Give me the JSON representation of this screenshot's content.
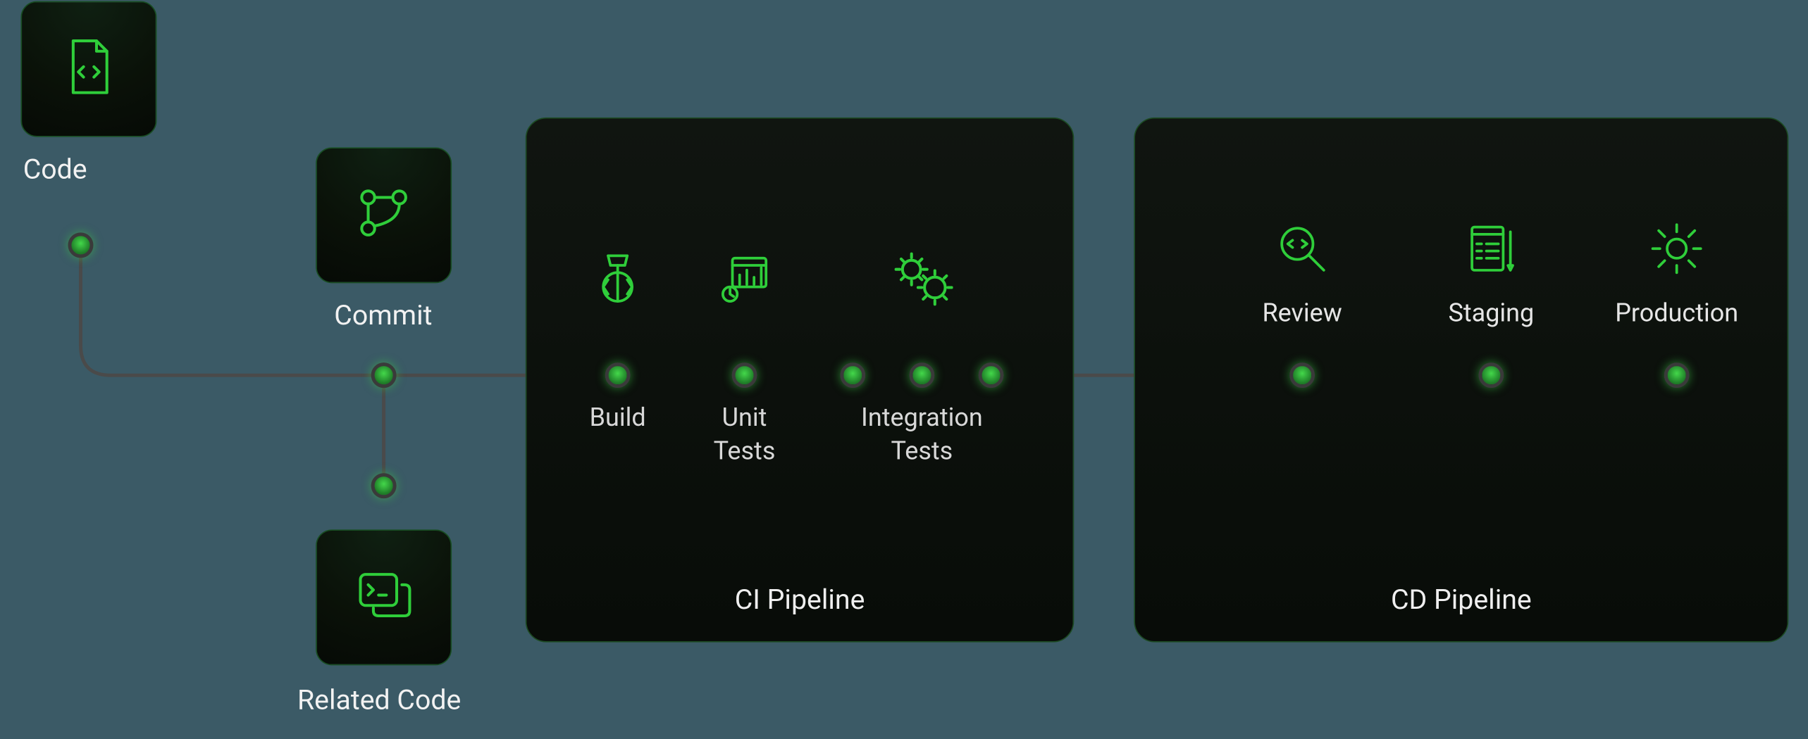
{
  "diagram": {
    "code_label": "Code",
    "commit_label": "Commit",
    "related_code_label": "Related Code",
    "ci_panel_title": "CI Pipeline",
    "cd_panel_title": "CD Pipeline",
    "ci_stages": {
      "build": "Build",
      "unit_tests_line1": "Unit",
      "unit_tests_line2": "Tests",
      "integration_line1": "Integration",
      "integration_line2": "Tests"
    },
    "cd_stages": {
      "review": "Review",
      "staging": "Staging",
      "production": "Production"
    },
    "colors": {
      "background": "#3b5a66",
      "accent_green": "#2fce3a",
      "panel_border": "#1c4a22",
      "text": "#efefef"
    }
  }
}
